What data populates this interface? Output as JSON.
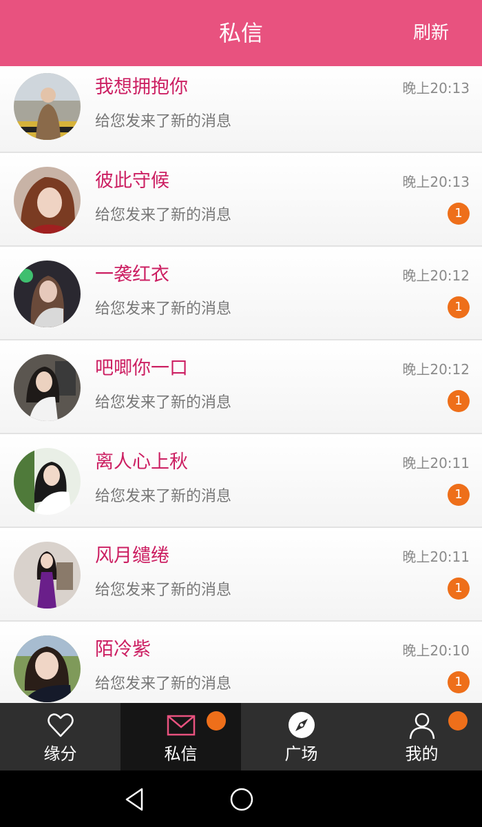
{
  "header": {
    "title": "私信",
    "refresh_label": "刷新"
  },
  "colors": {
    "brand": "#e8527f",
    "name": "#cc1f62",
    "badge": "#ee6f1a",
    "tabbar": "#2f2f2f"
  },
  "messages": [
    {
      "name": "我想拥抱你",
      "text": "给您发来了新的消息",
      "time": "晚上20:13",
      "badge": ""
    },
    {
      "name": "彼此守候",
      "text": "给您发来了新的消息",
      "time": "晚上20:13",
      "badge": "1"
    },
    {
      "name": "一袭红衣",
      "text": "给您发来了新的消息",
      "time": "晚上20:12",
      "badge": "1"
    },
    {
      "name": "吧唧你一口",
      "text": "给您发来了新的消息",
      "time": "晚上20:12",
      "badge": "1"
    },
    {
      "name": "离人心上秋",
      "text": "给您发来了新的消息",
      "time": "晚上20:11",
      "badge": "1"
    },
    {
      "name": "风月缱绻",
      "text": "给您发来了新的消息",
      "time": "晚上20:11",
      "badge": "1"
    },
    {
      "name": "陌冷紫",
      "text": "给您发来了新的消息",
      "time": "晚上20:10",
      "badge": "1"
    }
  ],
  "tabs": [
    {
      "label": "缘分",
      "icon": "heart-icon"
    },
    {
      "label": "私信",
      "icon": "envelope-icon"
    },
    {
      "label": "广场",
      "icon": "compass-icon"
    },
    {
      "label": "我的",
      "icon": "user-icon"
    }
  ],
  "system_nav": [
    "back-icon",
    "home-icon"
  ]
}
